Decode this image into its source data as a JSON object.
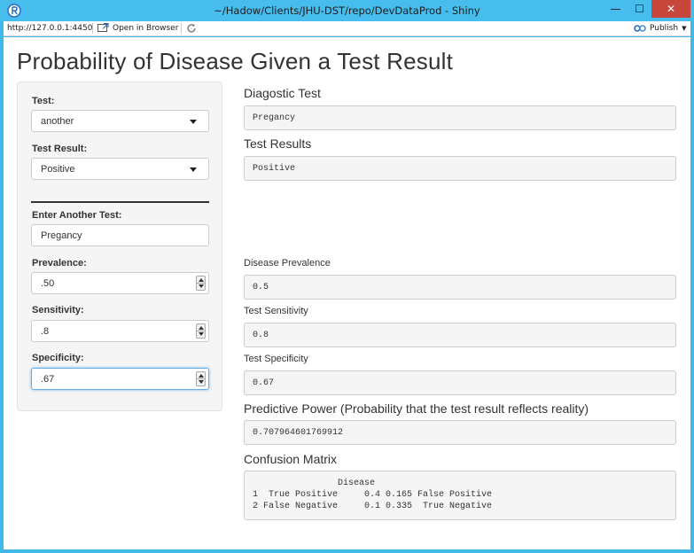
{
  "window": {
    "title": "~/Hadow/Clients/JHU-DST/repo/DevDataProd - Shiny",
    "min_glyph": "—",
    "max_glyph": "☐",
    "close_glyph": "✕"
  },
  "toolbar": {
    "url": "http://127.0.0.1:4450",
    "open_label": "Open in Browser",
    "publish_label": "Publish"
  },
  "page": {
    "title": "Probability of Disease Given a Test Result"
  },
  "sidebar": {
    "test_label": "Test:",
    "test_value": "another",
    "result_label": "Test Result:",
    "result_value": "Positive",
    "another_label": "Enter Another Test:",
    "another_value": "Pregancy",
    "prevalence_label": "Prevalence:",
    "prevalence_value": ".50",
    "sensitivity_label": "Sensitivity:",
    "sensitivity_value": ".8",
    "specificity_label": "Specificity:",
    "specificity_value": ".67"
  },
  "main": {
    "diag_heading": "Diagostic Test",
    "diag_value": "Pregancy",
    "results_heading": "Test Results",
    "results_value": "Positive",
    "prevalence_label": "Disease Prevalence",
    "prevalence_value": "0.5",
    "sensitivity_label": "Test Sensitivity",
    "sensitivity_value": "0.8",
    "specificity_label": "Test Specificity",
    "specificity_value": "0.67",
    "power_heading": "Predictive Power (Probability that the test result reflects reality)",
    "power_value": "0.707964601769912",
    "matrix_heading": "Confusion Matrix",
    "matrix_text": "                Disease\n1  True Positive     0.4 0.165 False Positive\n2 False Negative     0.1 0.335  True Negative"
  },
  "colors": {
    "titlebar": "#47bdee",
    "close_button": "#c7473c",
    "focus_ring": "#66afe9"
  }
}
